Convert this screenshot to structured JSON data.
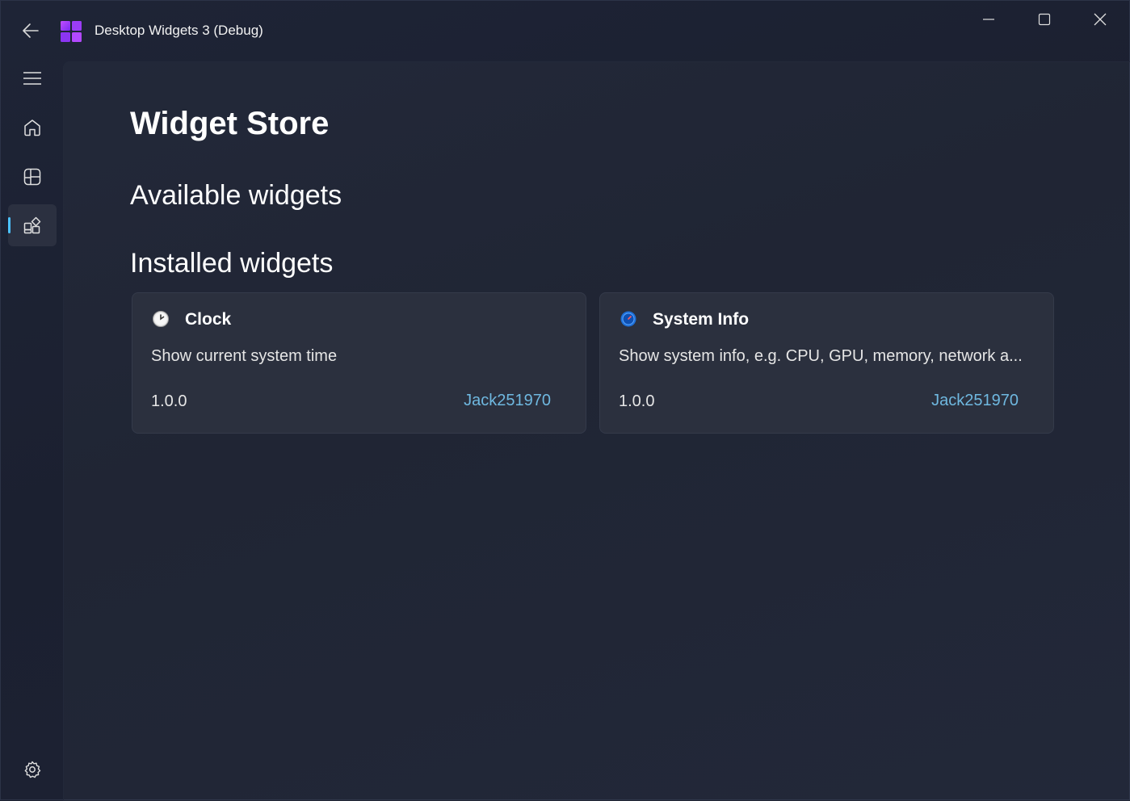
{
  "titlebar": {
    "app_title": "Desktop Widgets 3 (Debug)",
    "back_icon": "back-arrow-icon",
    "app_icon": "app-logo-icon",
    "minimize_icon": "minimize-icon",
    "maximize_icon": "maximize-icon",
    "close_icon": "close-icon"
  },
  "nav": {
    "items": [
      {
        "name": "menu",
        "icon": "hamburger-icon",
        "selected": false
      },
      {
        "name": "home",
        "icon": "home-icon",
        "selected": false
      },
      {
        "name": "widgets",
        "icon": "widgets-board-icon",
        "selected": false
      },
      {
        "name": "widget-store",
        "icon": "widget-store-icon",
        "selected": true
      },
      {
        "name": "settings",
        "icon": "gear-icon",
        "selected": false
      }
    ],
    "accent_color": "#4cc2ff"
  },
  "page": {
    "title": "Widget Store",
    "available_heading": "Available widgets",
    "installed_heading": "Installed widgets"
  },
  "installed_widgets": [
    {
      "name": "Clock",
      "icon": "clock-icon",
      "description": "Show current system time",
      "version": "1.0.0",
      "author": "Jack251970"
    },
    {
      "name": "System Info",
      "icon": "system-info-icon",
      "description": "Show system info, e.g. CPU, GPU, memory, network a...",
      "version": "1.0.0",
      "author": "Jack251970"
    }
  ]
}
